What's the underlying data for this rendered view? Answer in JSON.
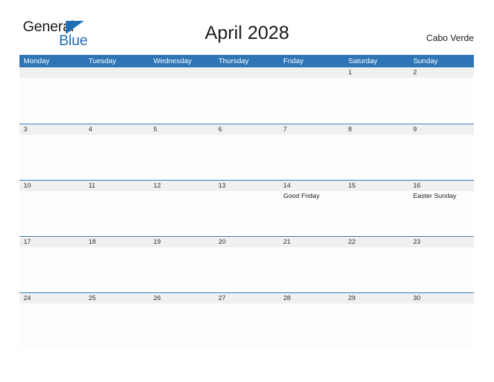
{
  "brand": {
    "name_part1": "General",
    "name_part2": "Blue",
    "triangle_icon": "triangle-icon",
    "color_primary": "#1f6fb5",
    "color_text": "#1a1a1a"
  },
  "header": {
    "title": "April 2028",
    "region": "Cabo Verde"
  },
  "calendar": {
    "header_color": "#2e75b6",
    "date_band_color": "#f0f0f0",
    "weekdays": [
      "Monday",
      "Tuesday",
      "Wednesday",
      "Thursday",
      "Friday",
      "Saturday",
      "Sunday"
    ],
    "weeks": [
      [
        {
          "day": "",
          "events": []
        },
        {
          "day": "",
          "events": []
        },
        {
          "day": "",
          "events": []
        },
        {
          "day": "",
          "events": []
        },
        {
          "day": "",
          "events": []
        },
        {
          "day": "1",
          "events": []
        },
        {
          "day": "2",
          "events": []
        }
      ],
      [
        {
          "day": "3",
          "events": []
        },
        {
          "day": "4",
          "events": []
        },
        {
          "day": "5",
          "events": []
        },
        {
          "day": "6",
          "events": []
        },
        {
          "day": "7",
          "events": []
        },
        {
          "day": "8",
          "events": []
        },
        {
          "day": "9",
          "events": []
        }
      ],
      [
        {
          "day": "10",
          "events": []
        },
        {
          "day": "11",
          "events": []
        },
        {
          "day": "12",
          "events": []
        },
        {
          "day": "13",
          "events": []
        },
        {
          "day": "14",
          "events": [
            "Good Friday"
          ]
        },
        {
          "day": "15",
          "events": []
        },
        {
          "day": "16",
          "events": [
            "Easter Sunday"
          ]
        }
      ],
      [
        {
          "day": "17",
          "events": []
        },
        {
          "day": "18",
          "events": []
        },
        {
          "day": "19",
          "events": []
        },
        {
          "day": "20",
          "events": []
        },
        {
          "day": "21",
          "events": []
        },
        {
          "day": "22",
          "events": []
        },
        {
          "day": "23",
          "events": []
        }
      ],
      [
        {
          "day": "24",
          "events": []
        },
        {
          "day": "25",
          "events": []
        },
        {
          "day": "26",
          "events": []
        },
        {
          "day": "27",
          "events": []
        },
        {
          "day": "28",
          "events": []
        },
        {
          "day": "29",
          "events": []
        },
        {
          "day": "30",
          "events": []
        }
      ]
    ]
  }
}
